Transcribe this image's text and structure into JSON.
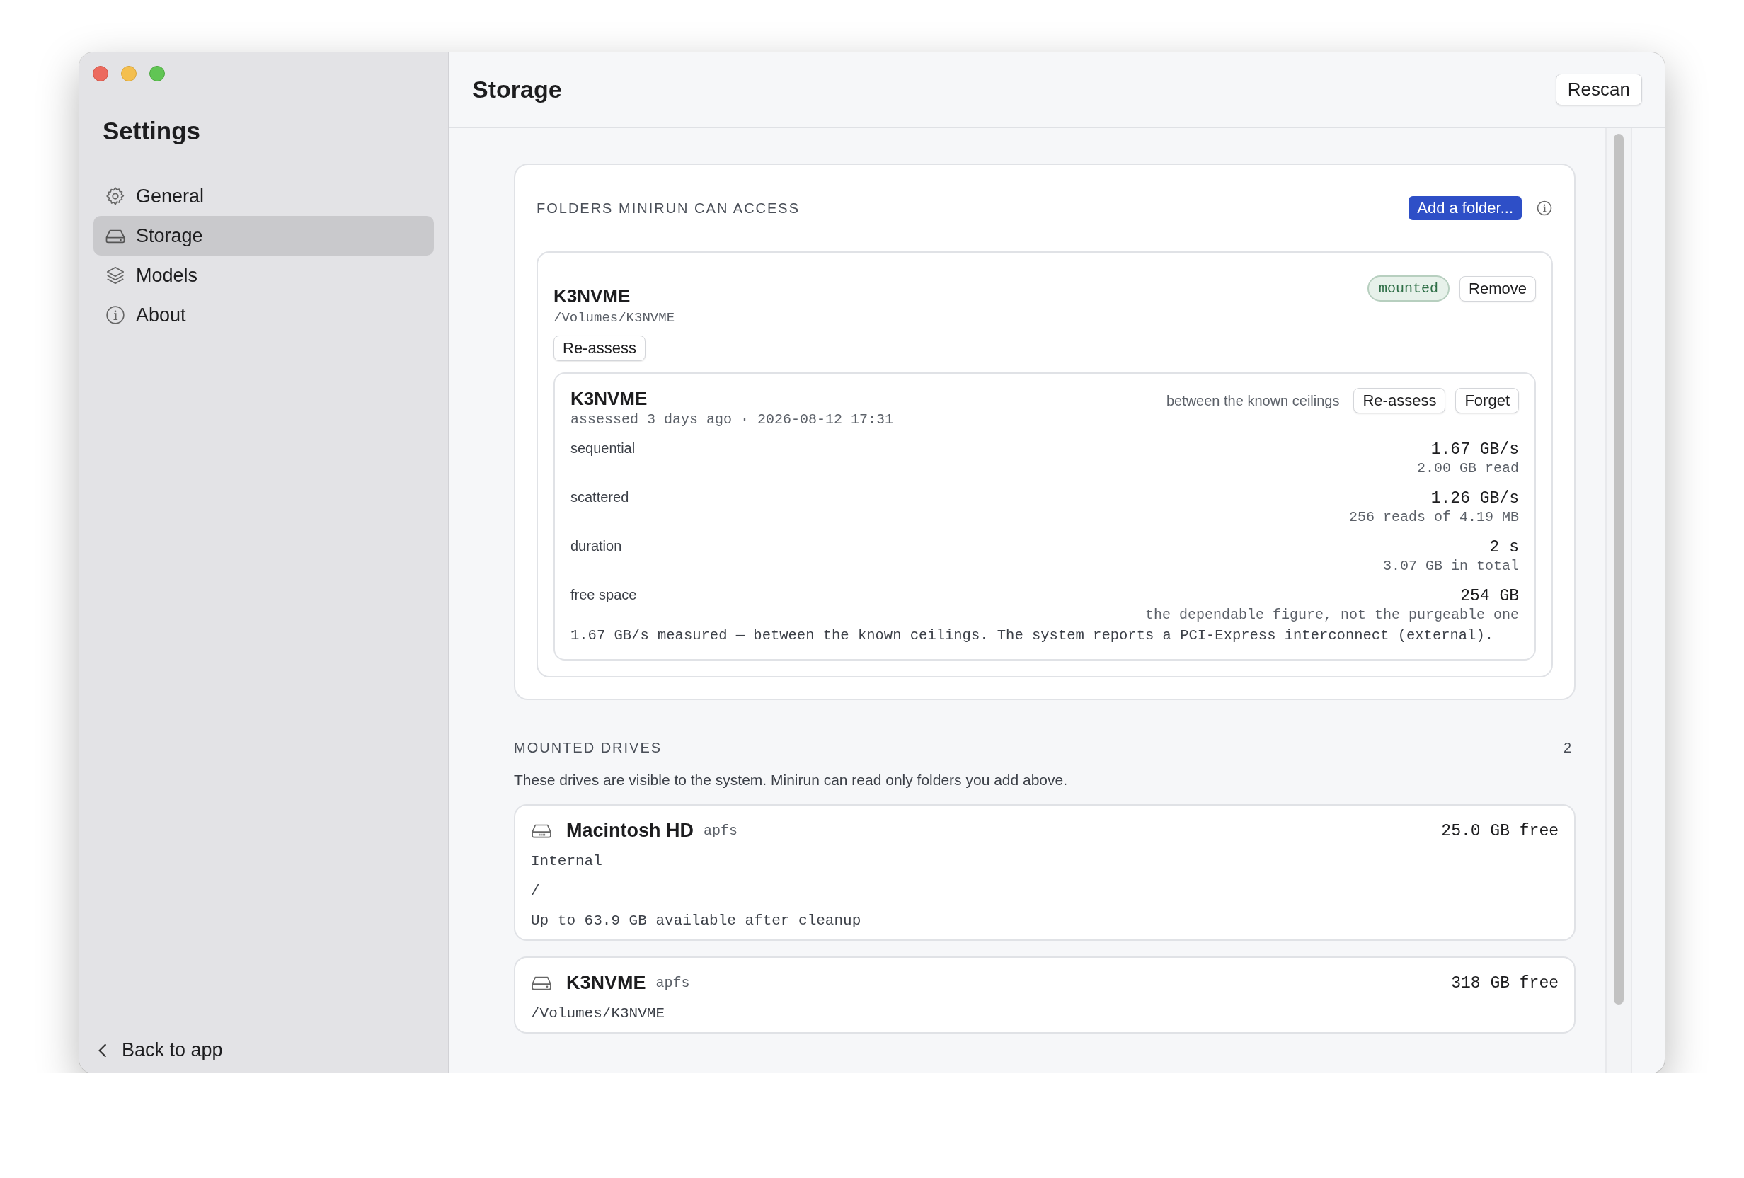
{
  "sidebar": {
    "title": "Settings",
    "items": [
      {
        "label": "General",
        "kind": "gear",
        "selected": false
      },
      {
        "label": "Storage",
        "kind": "drive",
        "selected": true
      },
      {
        "label": "Models",
        "kind": "layers",
        "selected": false
      },
      {
        "label": "About",
        "kind": "info",
        "selected": false
      }
    ],
    "footer": "Back to app"
  },
  "header": {
    "title": "Storage",
    "button": "Rescan"
  },
  "folders": {
    "heading": "FOLDERS MINIRUN CAN ACCESS",
    "add_button": "Add a folder...",
    "items": [
      {
        "name": "K3NVME",
        "path": "/Volumes/K3NVME",
        "status": "mounted",
        "remove": "Remove",
        "reassess": "Re-assess",
        "assessment": {
          "name": "K3NVME",
          "time": "assessed 3 days ago · 2026-08-12 17:31",
          "verdict": "between the known ceilings",
          "buttons": [
            "Re-assess",
            "Forget"
          ],
          "metrics": [
            {
              "label": "sequential",
              "value": "1.67 GB/s",
              "detail": "2.00 GB read"
            },
            {
              "label": "scattered",
              "value": "1.26 GB/s",
              "detail": "256 reads of 4.19 MB"
            },
            {
              "label": "duration",
              "value": "2 s",
              "detail": "3.07 GB in total"
            },
            {
              "label": "free space",
              "value": "254 GB",
              "detail": "the dependable figure, not the purgeable one"
            }
          ],
          "summary": "1.67 GB/s measured — between the known ceilings. The system reports a PCI-Express interconnect (external)."
        }
      }
    ]
  },
  "drives": {
    "heading": "MOUNTED DRIVES",
    "count": "2",
    "note": "These drives are visible to the system. Minirun can read only folders you add above.",
    "items": [
      {
        "name": "Macintosh HD",
        "kind": "internal",
        "fs": "apfs",
        "free": "25.0 GB free",
        "lines": [
          "Internal",
          "/",
          "Up to 63.9 GB available after cleanup"
        ]
      },
      {
        "name": "K3NVME",
        "kind": "external",
        "fs": "apfs",
        "free": "318 GB free",
        "lines": [
          "/Volumes/K3NVME"
        ]
      }
    ]
  }
}
